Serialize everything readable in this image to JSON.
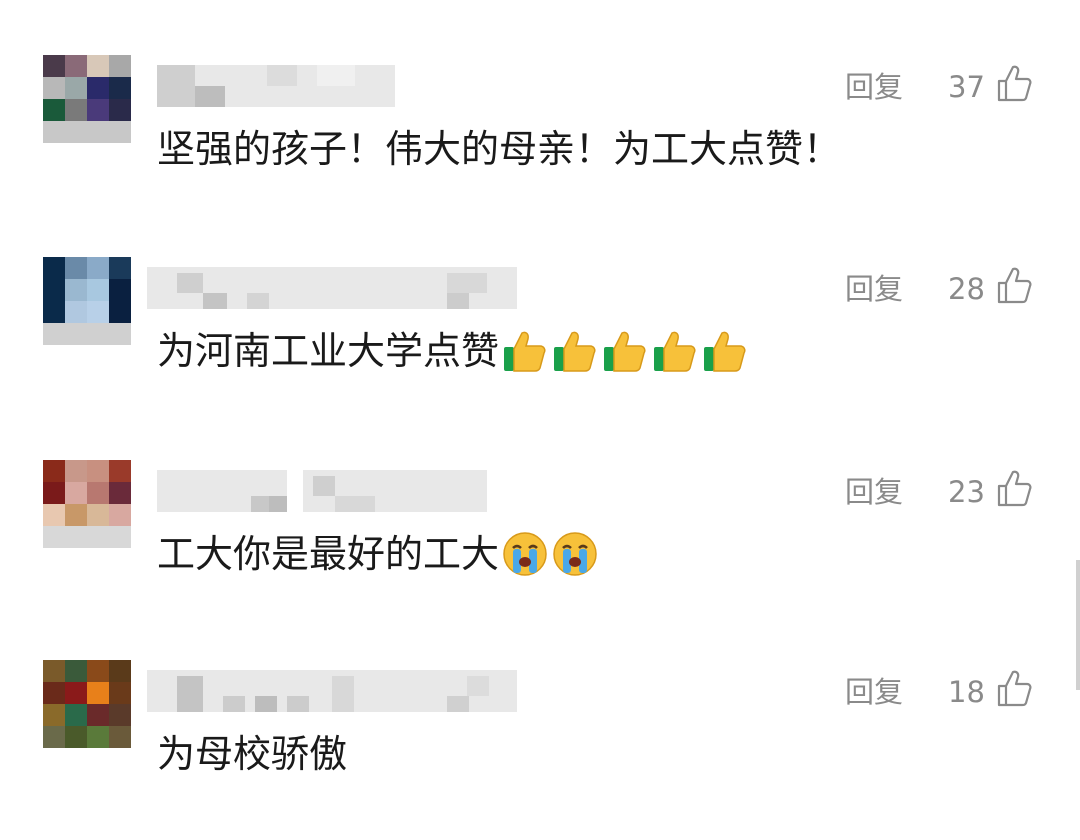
{
  "comments": [
    {
      "reply_label": "回复",
      "likes": "37",
      "text": "坚强的孩子！伟大的母亲！为工大点赞！",
      "emoji": [],
      "avatar_colors": [
        "#4a3a4a",
        "#8a6a78",
        "#d8c8b8",
        "#a8a8a8",
        "#b8b8b8",
        "#9aa8a8",
        "#2a2a6a",
        "#1a2a4a",
        "#1a5a3a",
        "#7a7a7a",
        "#4a3a7a",
        "#2a2a4a",
        "#c8c8c8",
        "#c8c8c8",
        "#c8c8c8",
        "#c8c8c8"
      ]
    },
    {
      "reply_label": "回复",
      "likes": "28",
      "text": "为河南工业大学点赞",
      "emoji": [
        "thumbs-up",
        "thumbs-up",
        "thumbs-up",
        "thumbs-up",
        "thumbs-up"
      ],
      "avatar_colors": [
        "#0a2a4a",
        "#6a8aa8",
        "#8aaac8",
        "#1a3a5a",
        "#0a2a4a",
        "#9ab8d0",
        "#a8c8e0",
        "#0a2040",
        "#0a2a4a",
        "#b0c8e0",
        "#b8d0e8",
        "#0a2040",
        "#d0d0d0",
        "#d0d0d0",
        "#d0d0d0",
        "#d0d0d0"
      ]
    },
    {
      "reply_label": "回复",
      "likes": "23",
      "text": "工大你是最好的工大",
      "emoji": [
        "loudly-crying-face",
        "loudly-crying-face"
      ],
      "avatar_colors": [
        "#8a2a1a",
        "#c8988a",
        "#c89080",
        "#9a3a2a",
        "#7a1a1a",
        "#d8a8a0",
        "#b87870",
        "#6a2a3a",
        "#e8c8b0",
        "#c89868",
        "#d8b898",
        "#d8a8a0",
        "#d8d8d8",
        "#d8d8d8",
        "#d8d8d8",
        "#d8d8d8"
      ]
    },
    {
      "reply_label": "回复",
      "likes": "18",
      "text": "为母校骄傲",
      "emoji": [],
      "avatar_colors": [
        "#7a5a2a",
        "#3a5a3a",
        "#8a4a1a",
        "#5a3a1a",
        "#6a2a1a",
        "#8a1a1a",
        "#e8801a",
        "#6a3a1a",
        "#8a6a2a",
        "#2a6a4a",
        "#6a2a2a",
        "#5a3a2a",
        "#6a6a4a",
        "#4a5a2a",
        "#5a7a3a",
        "#6a5a3a"
      ]
    }
  ]
}
